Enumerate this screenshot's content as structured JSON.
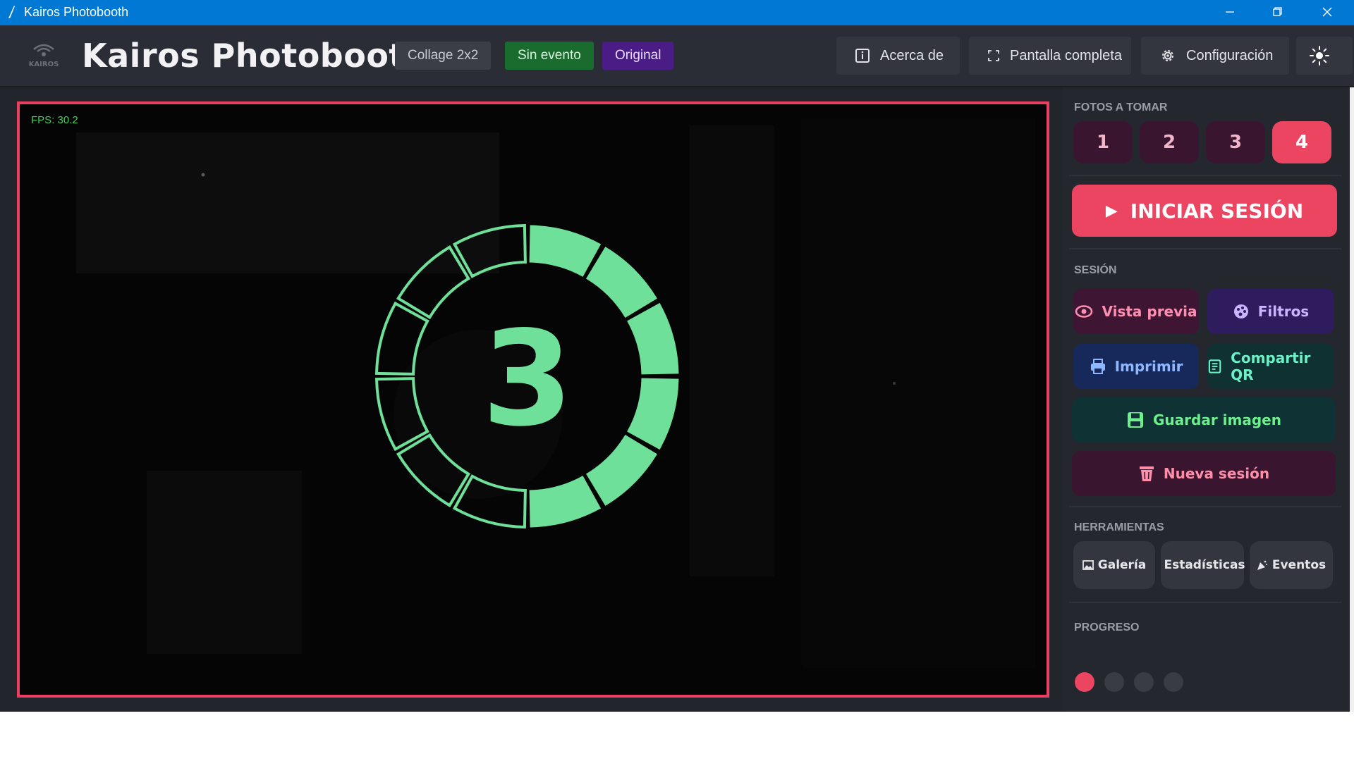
{
  "window": {
    "title": "Kairos Photobooth"
  },
  "header": {
    "app_title": "Kairos Photobooth",
    "logo_text": "KAIROS",
    "chips": {
      "collage": "Collage 2x2",
      "event": "Sin evento",
      "filter": "Original"
    },
    "buttons": {
      "about": "Acerca de",
      "fullscreen": "Pantalla completa",
      "config": "Configuración"
    }
  },
  "camera": {
    "fps": "FPS: 30.2",
    "countdown": "3",
    "countdown_fill_fraction": 0.5
  },
  "sidebar": {
    "photos_label": "FOTOS A TOMAR",
    "photo_options": [
      "1",
      "2",
      "3",
      "4"
    ],
    "selected_photo_count": "4",
    "start_button": "INICIAR SESIÓN",
    "session_label": "SESIÓN",
    "actions": {
      "preview": "Vista previa",
      "filters": "Filtros",
      "print": "Imprimir",
      "share_qr": "Compartir QR",
      "save_image": "Guardar imagen",
      "new_session": "Nueva sesión"
    },
    "tools_label": "HERRAMIENTAS",
    "tools": {
      "gallery": "Galería",
      "stats": "Estadísticas",
      "events": "Eventos"
    },
    "progress_label": "PROGRESO",
    "progress": {
      "done": 1,
      "total": 4
    }
  },
  "colors": {
    "accent": "#ec4561",
    "countdown": "#6ee09a",
    "titlebar": "#0078d4"
  }
}
